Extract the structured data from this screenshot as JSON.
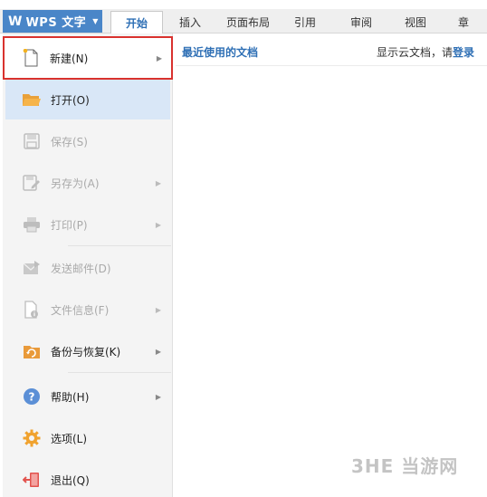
{
  "app": {
    "logo": "W",
    "name": "WPS 文字"
  },
  "tabs": [
    {
      "label": "开始",
      "active": true
    },
    {
      "label": "插入"
    },
    {
      "label": "页面布局"
    },
    {
      "label": "引用"
    },
    {
      "label": "审阅"
    },
    {
      "label": "视图"
    },
    {
      "label": "章"
    }
  ],
  "menu": {
    "new": "新建(N)",
    "open": "打开(O)",
    "save": "保存(S)",
    "save_as": "另存为(A)",
    "print": "打印(P)",
    "send_mail": "发送邮件(D)",
    "file_info": "文件信息(F)",
    "backup": "备份与恢复(K)",
    "help": "帮助(H)",
    "options": "选项(L)",
    "exit": "退出(Q)"
  },
  "content": {
    "recent_title": "最近使用的文档",
    "cloud_text": "显示云文档，请",
    "login": "登录"
  },
  "watermark": "3HE 当游网",
  "colors": {
    "accent": "#4a86c8",
    "link": "#2e6fb5",
    "highlight_border": "#d9322e",
    "hover": "#d9e7f7"
  }
}
